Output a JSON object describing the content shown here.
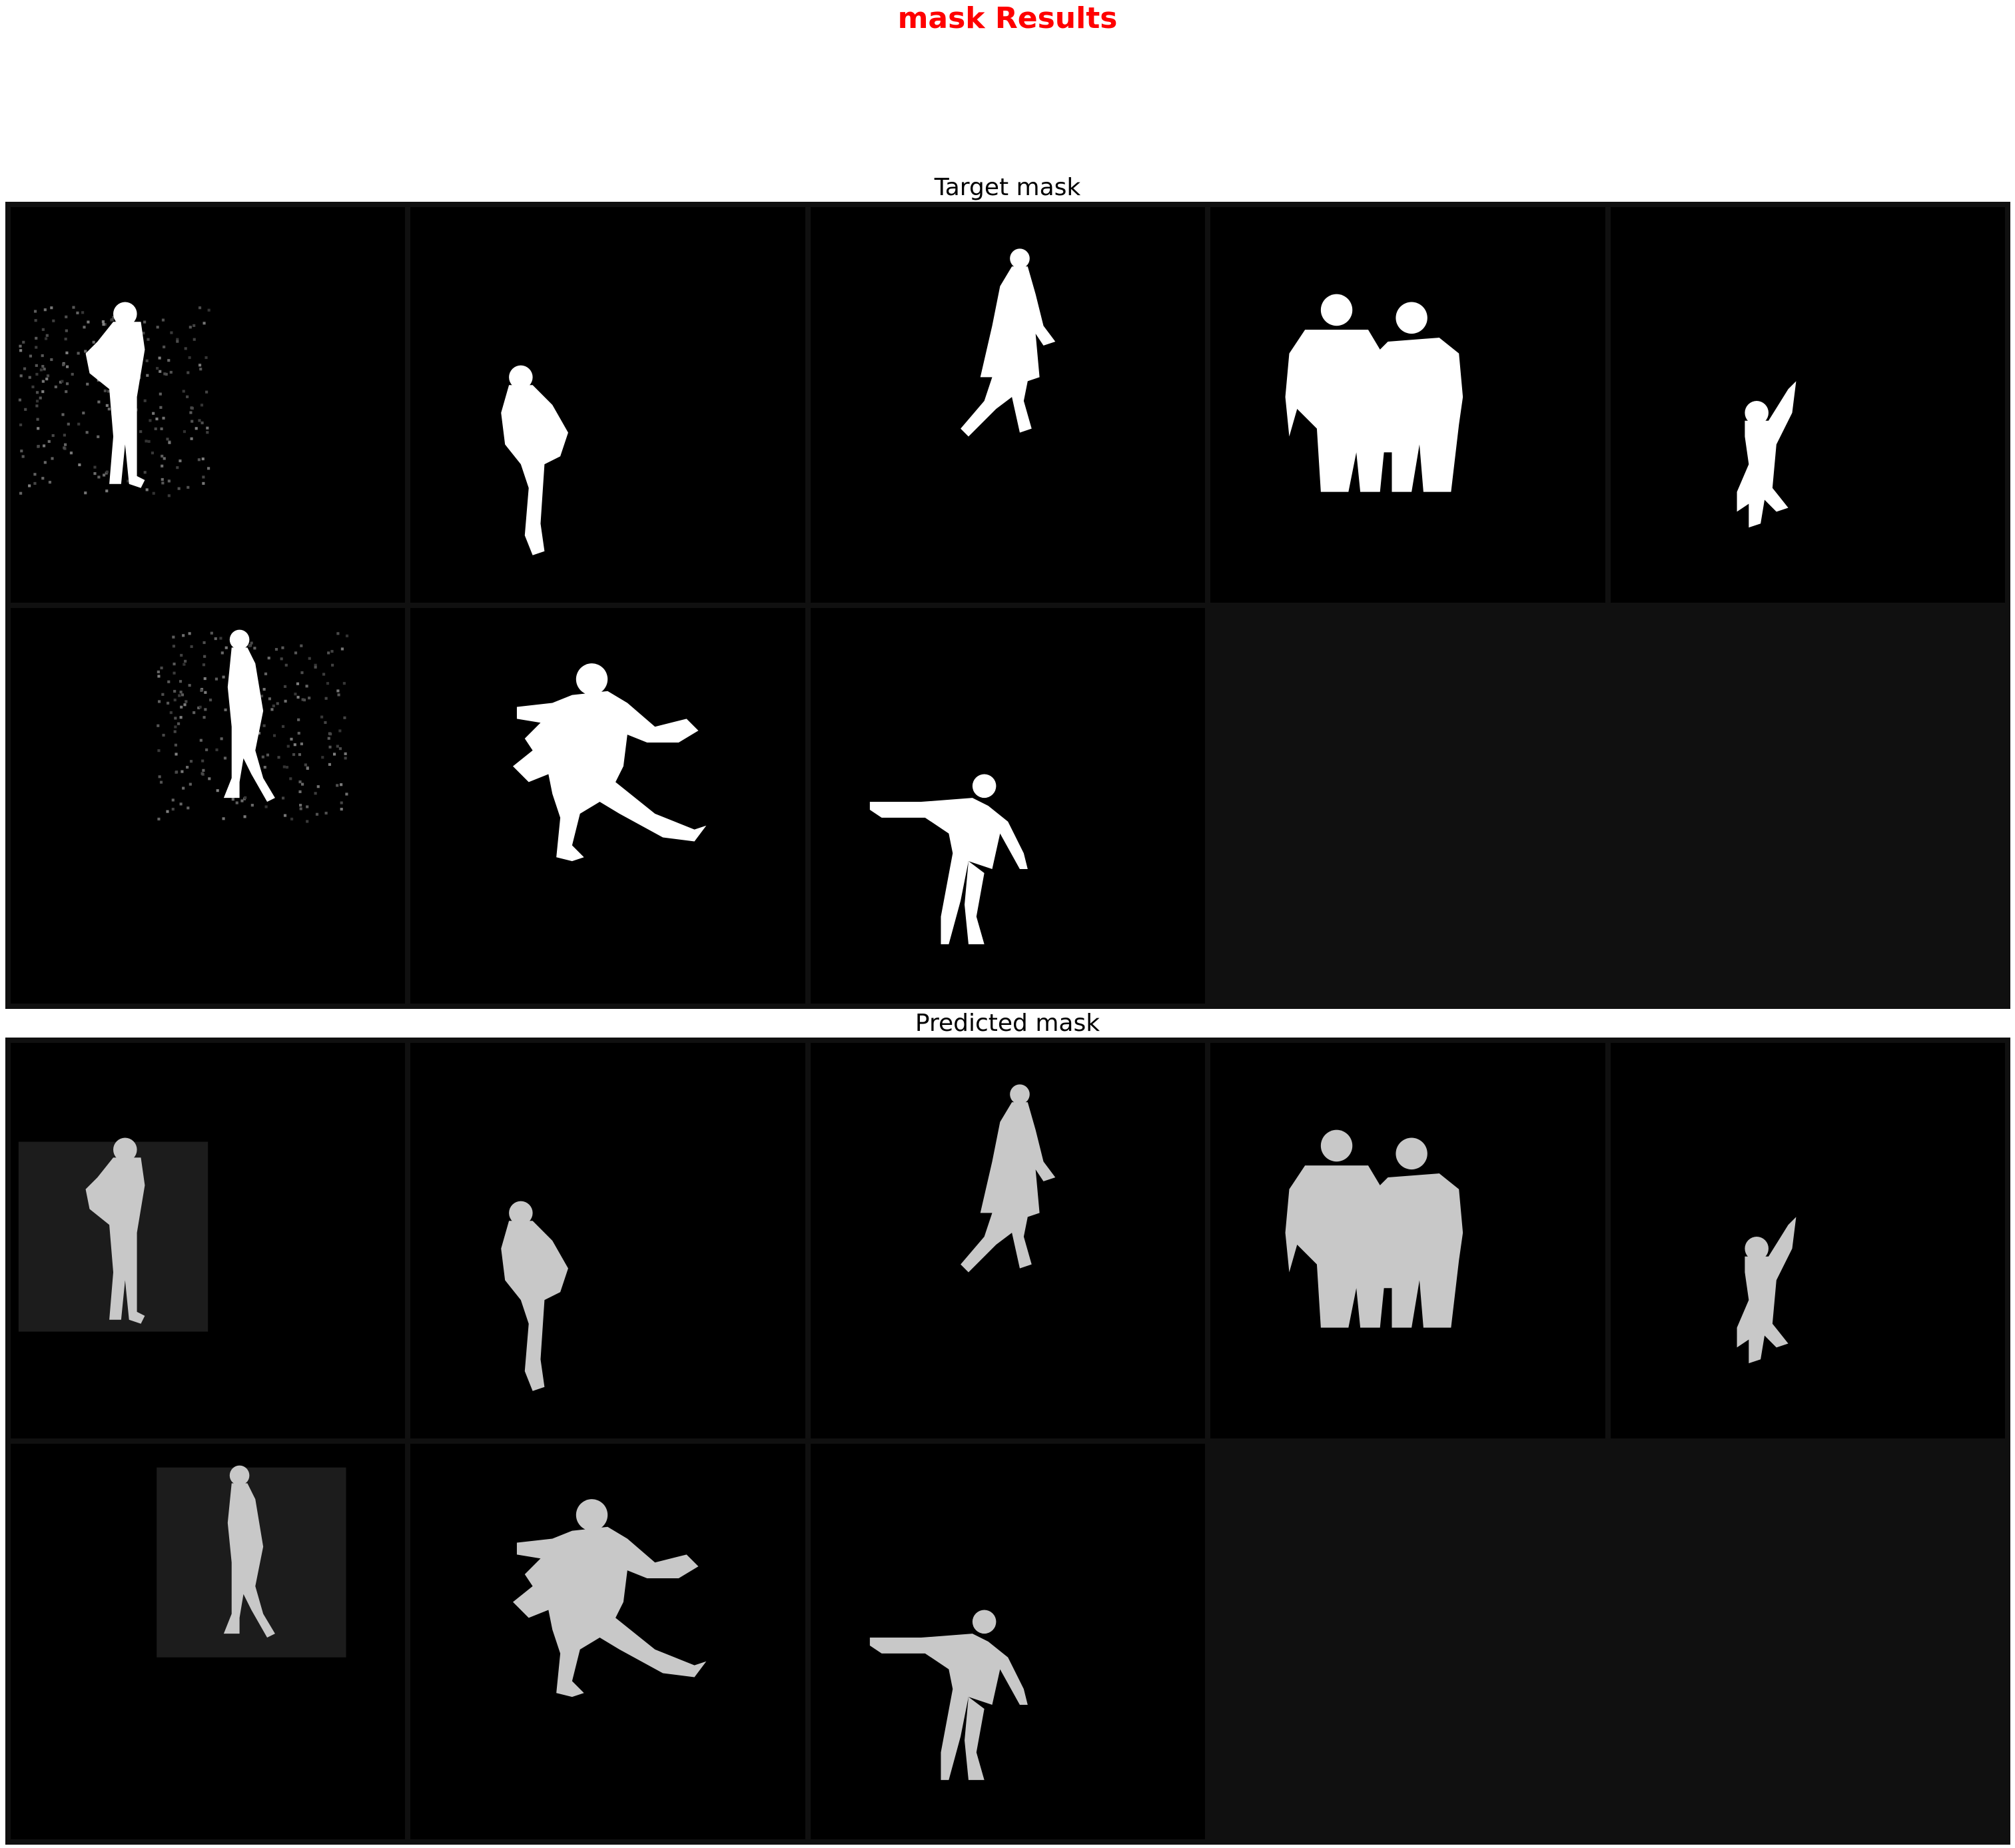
{
  "figure": {
    "title": "mask Results",
    "title_color": "#ff0000"
  },
  "panels": [
    {
      "title": "Target mask",
      "mask_color": "#ffffff",
      "tiles": [
        {
          "subject": "person-standing-hand-on-hip",
          "noise_box": true
        },
        {
          "subject": "person-standing-side"
        },
        {
          "subject": "person-walking"
        },
        {
          "subject": "two-people-standing"
        },
        {
          "subject": "person-jumping-arm-raised"
        },
        {
          "subject": "person-walking-small",
          "noise_box": true
        },
        {
          "subject": "person-dancing-leg-extended"
        },
        {
          "subject": "person-arms-outstretched"
        }
      ]
    },
    {
      "title": "Predicted mask",
      "mask_color": "#c8c8c8",
      "tiles": [
        {
          "subject": "person-standing-hand-on-hip",
          "noise_box": true
        },
        {
          "subject": "person-standing-side"
        },
        {
          "subject": "person-walking"
        },
        {
          "subject": "two-people-standing"
        },
        {
          "subject": "person-jumping-arm-raised"
        },
        {
          "subject": "person-walking-small",
          "noise_box": true
        },
        {
          "subject": "person-dancing-leg-extended"
        },
        {
          "subject": "person-arms-outstretched"
        }
      ]
    }
  ],
  "colors": {
    "tile_background": "#000000",
    "grid_padding": "#101010"
  }
}
